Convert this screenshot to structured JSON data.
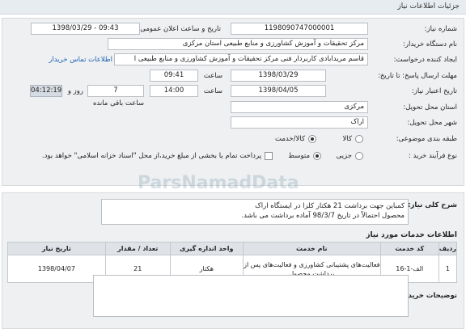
{
  "header": {
    "title": "جزئیات اطلاعات نیاز"
  },
  "form": {
    "need_number": {
      "label": "شماره نیاز:",
      "value": "1198090747000001"
    },
    "announce": {
      "label": "تاریخ و ساعت اعلان عمومی:",
      "value": "1398/03/29 - 09:43"
    },
    "buyer_org": {
      "label": "نام دستگاه خریدار:",
      "value": "مرکز تحقیقات و آموزش کشاورزی و منابع طبیعی استان مرکزی"
    },
    "creator": {
      "label": "ایجاد کننده درخواست:",
      "value": "قاسم مریدابادی کاربردار فنی مرکز تحقیقات و آموزش کشاورزی و منابع طبیعی ا",
      "link": "اطلاعات تماس خریدار"
    },
    "reply_deadline": {
      "label": "مهلت ارسال پاسخ: تا تاریخ:",
      "date": "1398/03/29",
      "time_label": "ساعت",
      "time": "09:41"
    },
    "price_deadline": {
      "label": "تاریخ اعتبار نیاز:",
      "date": "1398/04/05",
      "time_label": "ساعت",
      "time": "14:00",
      "days": "7",
      "days_label": "روز و",
      "remaining": "04:12:19",
      "remaining_label": "ساعت باقی مانده"
    },
    "province": {
      "label": "استان محل تحویل:",
      "value": "مرکزی"
    },
    "city": {
      "label": "شهر محل تحویل:",
      "value": "اراک"
    },
    "category": {
      "label": "طبقه بندی موضوعی:",
      "opt1": "کالا",
      "opt2": "کالا/خدمت"
    },
    "process": {
      "label": "نوع فرآیند خرید :",
      "opt1": "جزیی",
      "opt2": "متوسط",
      "note": "پرداخت تمام یا بخشی از مبلغ خرید،از محل \"اسناد خزانه اسلامی\" خواهد بود."
    }
  },
  "description": {
    "label": "شرح کلی نیاز:",
    "line1": "کمباین جهت برداشت 21 هکتار کلزا در ایستگاه اراک",
    "line2": "محصول احتمالاً در تاریخ 98/3/7 آماده برداشت می باشد."
  },
  "services": {
    "section_title": "اطلاعات خدمات مورد نیاز",
    "columns": [
      "ردیف",
      "کد خدمت",
      "نام خدمت",
      "واحد اندازه گیری",
      "تعداد / مقدار",
      "تاریخ نیاز"
    ],
    "rows": [
      {
        "row": "1",
        "code": "الف-1-16",
        "name": "فعالیت‌های پشتیبانی کشاورزی و فعالیت‌های پس از برداشت محصول",
        "unit": "هکتار",
        "qty": "21",
        "date": "1398/04/07"
      }
    ]
  },
  "buyer_notes": {
    "label": "توضیحات خریدار:"
  },
  "watermark": "ParsNamadData"
}
